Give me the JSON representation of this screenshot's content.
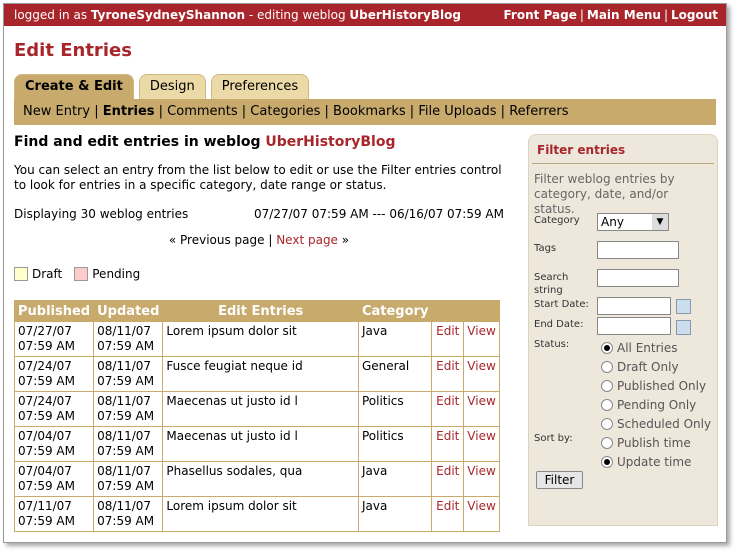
{
  "topbar": {
    "logged_prefix": "logged in as",
    "user": "TyroneSydneyShannon",
    "editing_prefix": "- editing weblog",
    "blog": "UberHistoryBlog",
    "links": [
      "Front Page",
      "Main Menu",
      "Logout"
    ]
  },
  "page_title": "Edit Entries",
  "tabs": [
    "Create & Edit",
    "Design",
    "Preferences"
  ],
  "subnav": [
    "New Entry",
    "Entries",
    "Comments",
    "Categories",
    "Bookmarks",
    "File Uploads",
    "Referrers"
  ],
  "main": {
    "heading_prefix": "Find and edit entries in weblog",
    "heading_blog": "UberHistoryBlog",
    "description": "You can select an entry from the list below to edit or use the Filter entries control to look for entries in a specific category, date range or status.",
    "displaying": "Displaying 30 weblog entries",
    "date_range": "07/27/07 07:59 AM --- 06/16/07 07:59 AM",
    "prev": "« Previous page",
    "next": "Next page",
    "next_arrow": "»",
    "legend_draft": "Draft",
    "legend_pending": "Pending"
  },
  "table": {
    "headers": [
      "Published",
      "Updated",
      "Edit Entries",
      "Category"
    ],
    "edit_label": "Edit",
    "view_label": "View",
    "rows": [
      {
        "pub1": "07/27/07",
        "pub2": "07:59 AM",
        "up1": "08/11/07",
        "up2": "07:59 AM",
        "title": "Lorem ipsum dolor sit",
        "cat": "Java"
      },
      {
        "pub1": "07/24/07",
        "pub2": "07:59 AM",
        "up1": "08/11/07",
        "up2": "07:59 AM",
        "title": "Fusce feugiat neque id",
        "cat": "General"
      },
      {
        "pub1": "07/24/07",
        "pub2": "07:59 AM",
        "up1": "08/11/07",
        "up2": "07:59 AM",
        "title": "Maecenas ut justo id l",
        "cat": "Politics"
      },
      {
        "pub1": "07/04/07",
        "pub2": "07:59 AM",
        "up1": "08/11/07",
        "up2": "07:59 AM",
        "title": "Maecenas ut justo id l",
        "cat": "Politics"
      },
      {
        "pub1": "07/04/07",
        "pub2": "07:59 AM",
        "up1": "08/11/07",
        "up2": "07:59 AM",
        "title": "Phasellus sodales, qua",
        "cat": "Java"
      },
      {
        "pub1": "07/11/07",
        "pub2": "07:59 AM",
        "up1": "08/11/07",
        "up2": "07:59 AM",
        "title": "Lorem ipsum dolor sit",
        "cat": "Java"
      }
    ]
  },
  "filter": {
    "title": "Filter entries",
    "description": "Filter weblog entries by category, date, and/or status.",
    "category_label": "Category",
    "category_value": "Any",
    "tags_label": "Tags",
    "search_label": "Search string",
    "start_label": "Start Date:",
    "end_label": "End Date:",
    "status_label": "Status:",
    "status_options": [
      "All Entries",
      "Draft Only",
      "Published Only",
      "Pending Only",
      "Scheduled Only"
    ],
    "sort_label": "Sort by:",
    "sort_options": [
      "Publish time",
      "Update time"
    ],
    "button": "Filter"
  },
  "colors": {
    "accent": "#a8262b",
    "tan": "#c7aa6c",
    "draft": "#ffffcc",
    "pending": "#ffcccc"
  }
}
